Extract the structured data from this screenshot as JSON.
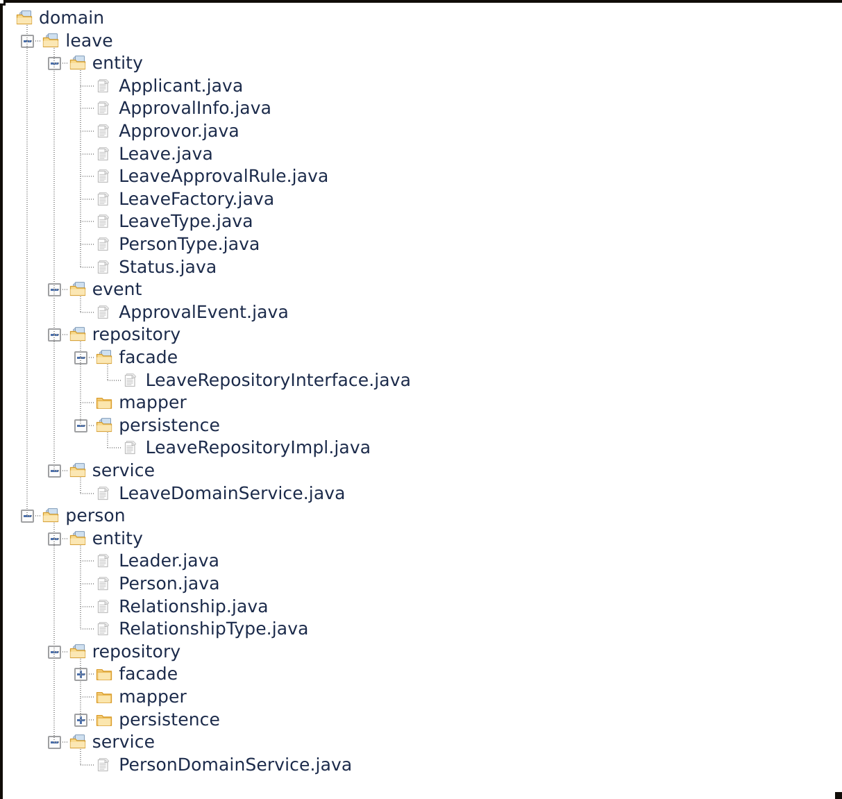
{
  "view": {
    "name": "project-explorer-tree",
    "background_color": "#ffffff",
    "text_color": "#1b2a4a",
    "folder_color": "#f5c873",
    "expander_accent_color": "#4a6ea9",
    "guide_line_color": "#9a9a9a"
  },
  "tree": {
    "nodes": [
      {
        "id": "domain",
        "label": "domain",
        "depth": 0,
        "type": "folder",
        "state": "open",
        "icon": "folder-open-icon"
      },
      {
        "id": "leave",
        "label": "leave",
        "depth": 1,
        "type": "folder",
        "state": "open",
        "icon": "folder-open-icon"
      },
      {
        "id": "leave-entity",
        "label": "entity",
        "depth": 2,
        "type": "folder",
        "state": "open",
        "icon": "folder-open-icon"
      },
      {
        "id": "applicant-java",
        "label": "Applicant.java",
        "depth": 3,
        "type": "file",
        "state": "leaf",
        "icon": "java-file-icon"
      },
      {
        "id": "approvalinfo-java",
        "label": "ApprovalInfo.java",
        "depth": 3,
        "type": "file",
        "state": "leaf",
        "icon": "java-file-icon"
      },
      {
        "id": "approvor-java",
        "label": "Approvor.java",
        "depth": 3,
        "type": "file",
        "state": "leaf",
        "icon": "java-file-icon"
      },
      {
        "id": "leave-java",
        "label": "Leave.java",
        "depth": 3,
        "type": "file",
        "state": "leaf",
        "icon": "java-file-icon"
      },
      {
        "id": "leaveapprovalrule-java",
        "label": "LeaveApprovalRule.java",
        "depth": 3,
        "type": "file",
        "state": "leaf",
        "icon": "java-file-icon"
      },
      {
        "id": "leavefactory-java",
        "label": "LeaveFactory.java",
        "depth": 3,
        "type": "file",
        "state": "leaf",
        "icon": "java-file-icon"
      },
      {
        "id": "leavetype-java",
        "label": "LeaveType.java",
        "depth": 3,
        "type": "file",
        "state": "leaf",
        "icon": "java-file-icon"
      },
      {
        "id": "persontype-java",
        "label": "PersonType.java",
        "depth": 3,
        "type": "file",
        "state": "leaf",
        "icon": "java-file-icon"
      },
      {
        "id": "status-java",
        "label": "Status.java",
        "depth": 3,
        "type": "file",
        "state": "leaf",
        "icon": "java-file-icon"
      },
      {
        "id": "leave-event",
        "label": "event",
        "depth": 2,
        "type": "folder",
        "state": "open",
        "icon": "folder-open-icon"
      },
      {
        "id": "approvalevent-java",
        "label": "ApprovalEvent.java",
        "depth": 3,
        "type": "file",
        "state": "leaf",
        "icon": "java-file-icon"
      },
      {
        "id": "leave-repository",
        "label": "repository",
        "depth": 2,
        "type": "folder",
        "state": "open",
        "icon": "folder-open-icon"
      },
      {
        "id": "leave-repository-facade",
        "label": "facade",
        "depth": 3,
        "type": "folder",
        "state": "open",
        "icon": "folder-open-icon"
      },
      {
        "id": "leaverepositoryinterface-java",
        "label": "LeaveRepositoryInterface.java",
        "depth": 4,
        "type": "file",
        "state": "leaf",
        "icon": "java-file-icon"
      },
      {
        "id": "leave-repository-mapper",
        "label": "mapper",
        "depth": 3,
        "type": "folder",
        "state": "empty",
        "icon": "folder-closed-icon"
      },
      {
        "id": "leave-repository-persistence",
        "label": "persistence",
        "depth": 3,
        "type": "folder",
        "state": "open",
        "icon": "folder-open-icon"
      },
      {
        "id": "leaverepositoryimpl-java",
        "label": "LeaveRepositoryImpl.java",
        "depth": 4,
        "type": "file",
        "state": "leaf",
        "icon": "java-file-icon"
      },
      {
        "id": "leave-service",
        "label": "service",
        "depth": 2,
        "type": "folder",
        "state": "open",
        "icon": "folder-open-icon"
      },
      {
        "id": "leavedomainservice-java",
        "label": "LeaveDomainService.java",
        "depth": 3,
        "type": "file",
        "state": "leaf",
        "icon": "java-file-icon"
      },
      {
        "id": "person",
        "label": "person",
        "depth": 1,
        "type": "folder",
        "state": "open",
        "icon": "folder-open-icon"
      },
      {
        "id": "person-entity",
        "label": "entity",
        "depth": 2,
        "type": "folder",
        "state": "open",
        "icon": "folder-open-icon"
      },
      {
        "id": "leader-java",
        "label": "Leader.java",
        "depth": 3,
        "type": "file",
        "state": "leaf",
        "icon": "java-file-icon"
      },
      {
        "id": "person-java",
        "label": "Person.java",
        "depth": 3,
        "type": "file",
        "state": "leaf",
        "icon": "java-file-icon"
      },
      {
        "id": "relationship-java",
        "label": "Relationship.java",
        "depth": 3,
        "type": "file",
        "state": "leaf",
        "icon": "java-file-icon"
      },
      {
        "id": "relationshiptype-java",
        "label": "RelationshipType.java",
        "depth": 3,
        "type": "file",
        "state": "leaf",
        "icon": "java-file-icon"
      },
      {
        "id": "person-repository",
        "label": "repository",
        "depth": 2,
        "type": "folder",
        "state": "open",
        "icon": "folder-open-icon"
      },
      {
        "id": "person-repository-facade",
        "label": "facade",
        "depth": 3,
        "type": "folder",
        "state": "collapsed",
        "icon": "folder-closed-icon"
      },
      {
        "id": "person-repository-mapper",
        "label": "mapper",
        "depth": 3,
        "type": "folder",
        "state": "empty",
        "icon": "folder-closed-icon"
      },
      {
        "id": "person-repository-persistence",
        "label": "persistence",
        "depth": 3,
        "type": "folder",
        "state": "collapsed",
        "icon": "folder-closed-icon"
      },
      {
        "id": "person-service",
        "label": "service",
        "depth": 2,
        "type": "folder",
        "state": "open",
        "icon": "folder-open-icon"
      },
      {
        "id": "persondomainservice-java",
        "label": "PersonDomainService.java",
        "depth": 3,
        "type": "file",
        "state": "leaf",
        "icon": "java-file-icon"
      }
    ]
  }
}
